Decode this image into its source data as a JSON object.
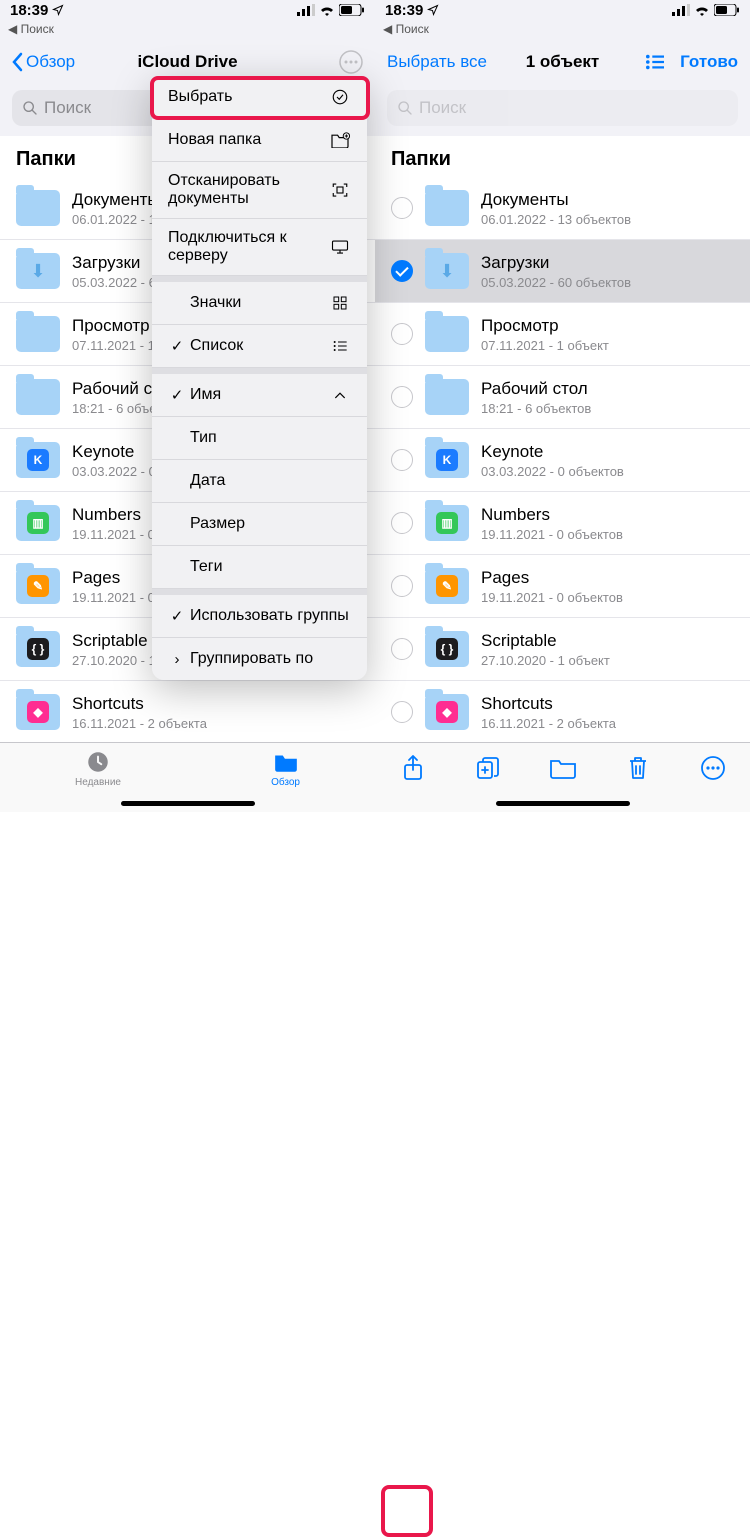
{
  "status": {
    "time": "18:39",
    "back_app": "Поиск"
  },
  "left": {
    "nav": {
      "back": "Обзор",
      "title": "iCloud Drive"
    },
    "search_placeholder": "Поиск",
    "section": "Папки",
    "tabs": {
      "recent": "Недавние",
      "browse": "Обзор"
    }
  },
  "right": {
    "nav": {
      "select_all": "Выбрать все",
      "title": "1 объект",
      "done": "Готово"
    },
    "search_placeholder": "Поиск",
    "section": "Папки"
  },
  "menu": {
    "select": "Выбрать",
    "new_folder": "Новая папка",
    "scan": "Отсканировать документы",
    "connect": "Подключиться к серверу",
    "icons": "Значки",
    "list": "Список",
    "name": "Имя",
    "type": "Тип",
    "date": "Дата",
    "size": "Размер",
    "tags": "Теги",
    "use_groups": "Использовать группы",
    "group_by": "Группировать по"
  },
  "folders": [
    {
      "name": "Документы",
      "sub": "06.01.2022 - 13 объектов",
      "glyph": "",
      "glyph_bg": ""
    },
    {
      "name": "Загрузки",
      "sub": "05.03.2022 - 60 объектов",
      "glyph": "⬇",
      "glyph_bg": ""
    },
    {
      "name": "Просмотр",
      "sub": "07.11.2021 - 1 объект",
      "glyph": "",
      "glyph_bg": ""
    },
    {
      "name": "Рабочий стол",
      "sub": "18:21 - 6 объектов",
      "glyph": "",
      "glyph_bg": ""
    },
    {
      "name": "Keynote",
      "sub": "03.03.2022 - 0 объектов",
      "glyph": "K",
      "glyph_bg": "#1b7bff"
    },
    {
      "name": "Numbers",
      "sub": "19.11.2021 - 0 объектов",
      "glyph": "▥",
      "glyph_bg": "#34c759"
    },
    {
      "name": "Pages",
      "sub": "19.11.2021 - 0 объектов",
      "glyph": "✎",
      "glyph_bg": "#ff9500"
    },
    {
      "name": "Scriptable",
      "sub": "27.10.2020 - 1 объект",
      "glyph": "{ }",
      "glyph_bg": "#1c1c1e"
    },
    {
      "name": "Shortcuts",
      "sub": "16.11.2021 - 2 объекта",
      "glyph": "◆",
      "glyph_bg": "#ff2d92"
    }
  ],
  "left_truncated": [
    "Документы",
    "Загрузки",
    "Просмотр",
    "Рабочий с",
    "Keynote",
    "Numbers",
    "Pages",
    "Scriptable",
    "Shortcuts"
  ],
  "selected_index": 1
}
